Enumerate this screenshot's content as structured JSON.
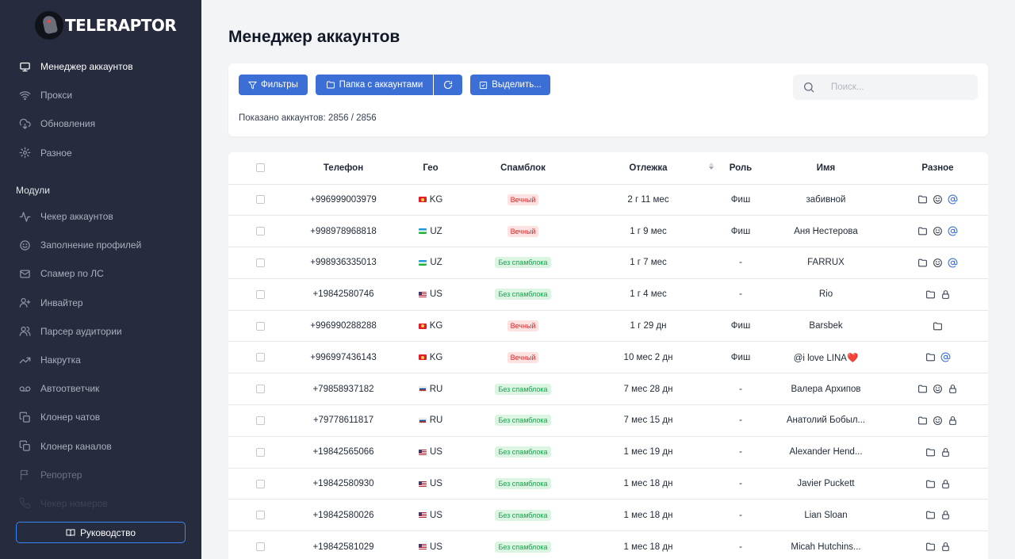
{
  "app": {
    "logo_text": "TELERAPTOR"
  },
  "sidebar": {
    "main_items": [
      {
        "label": "Менеджер аккаунтов",
        "icon": "monitor-icon",
        "active": true
      },
      {
        "label": "Прокси",
        "icon": "wifi-icon"
      },
      {
        "label": "Обновления",
        "icon": "cloud-download-icon"
      },
      {
        "label": "Разное",
        "icon": "gear-icon"
      }
    ],
    "section_title": "Модули",
    "module_items": [
      {
        "label": "Чекер аккаунтов",
        "icon": "activity-icon"
      },
      {
        "label": "Заполнение профилей",
        "icon": "smile-icon"
      },
      {
        "label": "Спамер по ЛС",
        "icon": "mail-icon"
      },
      {
        "label": "Инвайтер",
        "icon": "user-plus-icon"
      },
      {
        "label": "Парсер аудитории",
        "icon": "users-icon"
      },
      {
        "label": "Накрутка",
        "icon": "trending-up-icon"
      },
      {
        "label": "Автоответчик",
        "icon": "voicemail-icon"
      },
      {
        "label": "Клонер чатов",
        "icon": "copy-icon"
      },
      {
        "label": "Клонер каналов",
        "icon": "copy-icon"
      },
      {
        "label": "Репортер",
        "icon": "flag-icon",
        "dim": true
      },
      {
        "label": "Чекер номеров",
        "icon": "phone-icon",
        "faded": true
      }
    ],
    "guide_label": "Руководство"
  },
  "main": {
    "title": "Менеджер аккаунтов",
    "toolbar": {
      "filters_label": "Фильтры",
      "folder_label": "Папка с аккаунтами",
      "select_label": "Выделить...",
      "search_placeholder": "Поиск...",
      "shown_text": "Показано аккаунтов: 2856 / 2856"
    },
    "table": {
      "columns": [
        "Телефон",
        "Гео",
        "Спамблок",
        "Отлежка",
        "Роль",
        "Имя",
        "Разное"
      ],
      "rows": [
        {
          "phone": "+996999003979",
          "geo": "KG",
          "spam": "Вечный",
          "spam_type": "red",
          "age": "2 г 11 мес",
          "role": "Фиш",
          "name": "забивной",
          "misc": [
            "folder-icon",
            "smile-icon",
            "at-sign-icon"
          ]
        },
        {
          "phone": "+998978968818",
          "geo": "UZ",
          "spam": "Вечный",
          "spam_type": "red",
          "age": "1 г 9 мес",
          "role": "Фиш",
          "name": "Аня Нестерова",
          "misc": [
            "folder-icon",
            "smile-icon",
            "at-sign-icon"
          ]
        },
        {
          "phone": "+998936335013",
          "geo": "UZ",
          "spam": "Без спамблока",
          "spam_type": "green",
          "age": "1 г 7 мес",
          "role": "-",
          "name": "FARRUX",
          "misc": [
            "folder-icon",
            "smile-icon",
            "at-sign-icon"
          ]
        },
        {
          "phone": "+19842580746",
          "geo": "US",
          "spam": "Без спамблока",
          "spam_type": "green",
          "age": "1 г 4 мес",
          "role": "-",
          "name": "Rio",
          "misc": [
            "folder-icon",
            "lock-icon"
          ]
        },
        {
          "phone": "+996990288288",
          "geo": "KG",
          "spam": "Вечный",
          "spam_type": "red",
          "age": "1 г 29 дн",
          "role": "Фиш",
          "name": "Barsbek",
          "misc": [
            "folder-icon"
          ]
        },
        {
          "phone": "+996997436143",
          "geo": "KG",
          "spam": "Вечный",
          "spam_type": "red",
          "age": "10 мес 2 дн",
          "role": "Фиш",
          "name": "@i love LINA❤️",
          "misc": [
            "folder-icon",
            "at-sign-icon"
          ]
        },
        {
          "phone": "+79858937182",
          "geo": "RU",
          "spam": "Без спамблока",
          "spam_type": "green",
          "age": "7 мес 28 дн",
          "role": "-",
          "name": "Валера Архипов",
          "misc": [
            "folder-icon",
            "smile-icon",
            "lock-icon"
          ]
        },
        {
          "phone": "+79778611817",
          "geo": "RU",
          "spam": "Без спамблока",
          "spam_type": "green",
          "age": "7 мес 15 дн",
          "role": "-",
          "name": "Анатолий Бобыл...",
          "misc": [
            "folder-icon",
            "smile-icon",
            "lock-icon"
          ]
        },
        {
          "phone": "+19842565066",
          "geo": "US",
          "spam": "Без спамблока",
          "spam_type": "green",
          "age": "1 мес 19 дн",
          "role": "-",
          "name": "Alexander Hend...",
          "misc": [
            "folder-icon",
            "lock-icon"
          ]
        },
        {
          "phone": "+19842580930",
          "geo": "US",
          "spam": "Без спамблока",
          "spam_type": "green",
          "age": "1 мес 18 дн",
          "role": "-",
          "name": "Javier Puckett",
          "misc": [
            "folder-icon",
            "lock-icon"
          ]
        },
        {
          "phone": "+19842580026",
          "geo": "US",
          "spam": "Без спамблока",
          "spam_type": "green",
          "age": "1 мес 18 дн",
          "role": "-",
          "name": "Lian Sloan",
          "misc": [
            "folder-icon",
            "lock-icon"
          ]
        },
        {
          "phone": "+19842581029",
          "geo": "US",
          "spam": "Без спамблока",
          "spam_type": "green",
          "age": "1 мес 18 дн",
          "role": "-",
          "name": "Micah Hutchins...",
          "misc": [
            "folder-icon",
            "lock-icon"
          ]
        }
      ]
    }
  },
  "colors": {
    "sidebar_bg": "#262b3d",
    "accent": "#3b6fd6",
    "spam_red": "#dc2626",
    "spam_green": "#16a34a"
  }
}
